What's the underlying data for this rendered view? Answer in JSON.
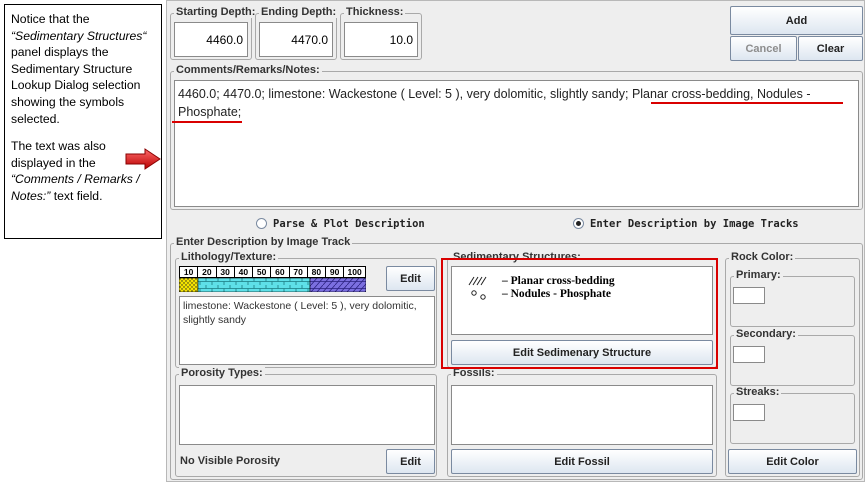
{
  "callout": {
    "p1_a": "Notice that the",
    "p1_b": "“Sedimentary Structures“",
    "p1_c": "panel displays the Sedimentary Structure Lookup Dialog selection showing the symbols selected.",
    "p2_a": "The  text was also displayed in the",
    "p2_b": "“Comments / Remarks / Notes:”",
    "p2_c": "text field."
  },
  "depth": {
    "starting_label": "Starting Depth:",
    "starting_value": "4460.0",
    "ending_label": "Ending Depth:",
    "ending_value": "4470.0",
    "thickness_label": "Thickness:",
    "thickness_value": "10.0"
  },
  "buttons": {
    "add": "Add",
    "cancel": "Cancel",
    "clear": "Clear"
  },
  "comments": {
    "label": "Comments/Remarks/Notes:",
    "text_plain": "4460.0; 4470.0; limestone: Wackestone ( Level: 5 ), very dolomitic, slightly sandy; ",
    "text_highlight_1": "Planar cross-bedding, Nodules -",
    "text_highlight_2": "Phosphate;"
  },
  "modes": {
    "parse": "Parse & Plot Description",
    "image": "Enter Description by Image Tracks",
    "selected": "image"
  },
  "image_track": {
    "label": "Enter Description by Image Track",
    "lithology": {
      "label": "Lithology/Texture:",
      "scale": [
        "10",
        "20",
        "30",
        "40",
        "50",
        "60",
        "70",
        "80",
        "90",
        "100"
      ],
      "edit": "Edit",
      "description": "limestone: Wackestone ( Level: 5 ), very dolomitic, slightly sandy"
    },
    "sedimentary": {
      "label": "Sedimentary Structures:",
      "items": [
        {
          "symbol": "cross-bedding-icon",
          "text": "– Planar cross-bedding"
        },
        {
          "symbol": "nodules-icon",
          "text": "– Nodules - Phosphate"
        }
      ],
      "edit": "Edit Sedimenary Structure"
    },
    "rock_color": {
      "label": "Rock Color:",
      "primary": "Primary:",
      "secondary": "Secondary:",
      "streaks": "Streaks:",
      "edit": "Edit Color"
    },
    "porosity": {
      "label": "Porosity Types:",
      "status": "No Visible Porosity",
      "edit": "Edit"
    },
    "fossils": {
      "label": "Fossils:",
      "edit": "Edit Fossil"
    }
  },
  "colors": {
    "highlight": "#d90000",
    "limestone": "#5ee0e8",
    "dolomite": "#7b6fe0",
    "sand": "#f5e400"
  }
}
